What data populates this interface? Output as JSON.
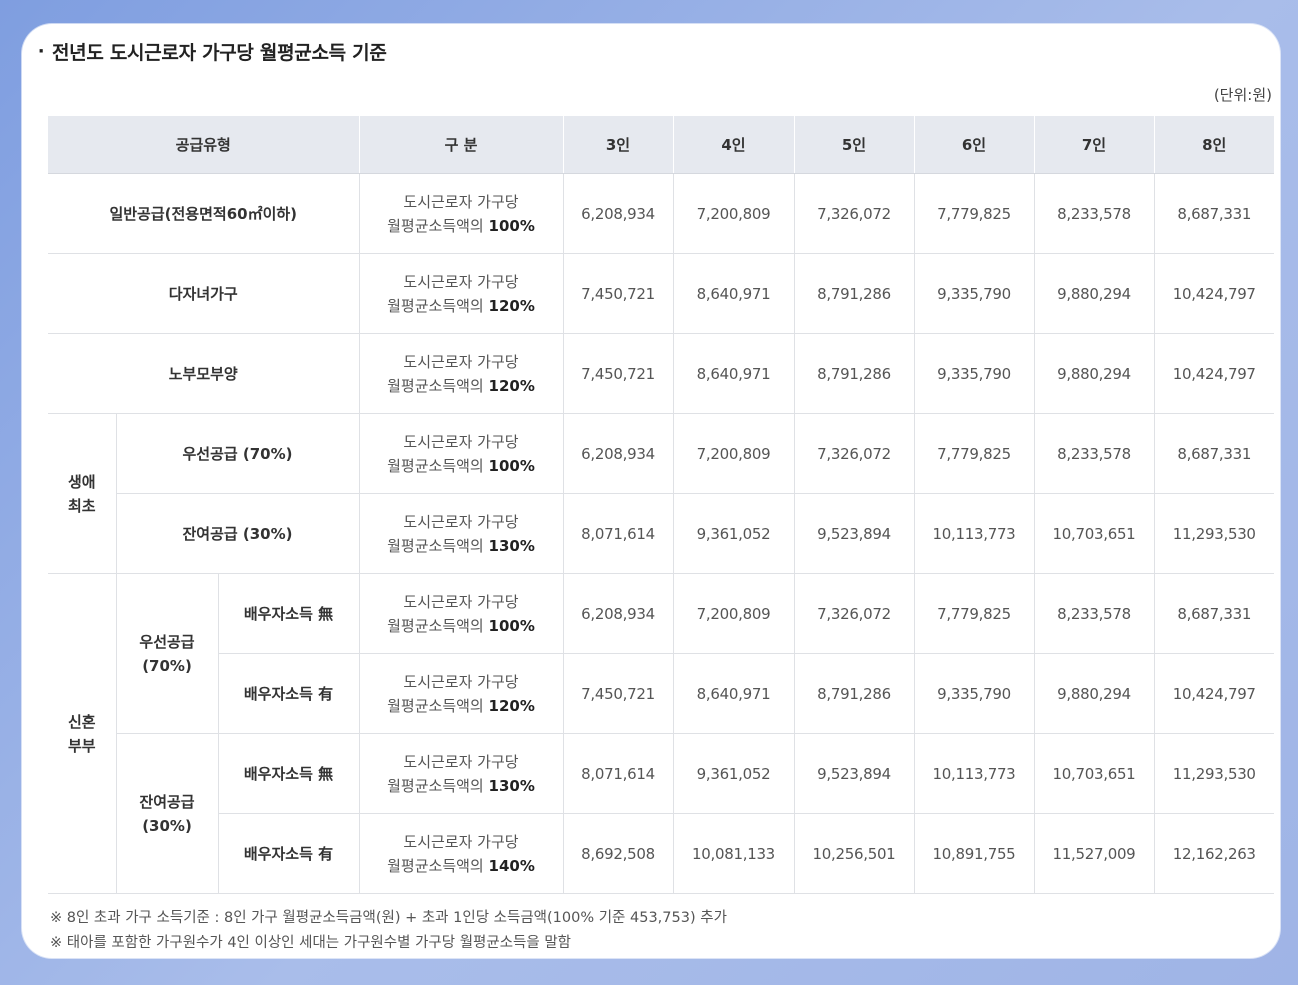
{
  "title": "전년도 도시근로자 가구당 월평균소득 기준",
  "unit": "(단위:원)",
  "header": {
    "supply_type": "공급유형",
    "division": "구 분",
    "columns": [
      "3인",
      "4인",
      "5인",
      "6인",
      "7인",
      "8인"
    ]
  },
  "desc_prefix_line1": "도시근로자 가구당",
  "desc_prefix_line2": "월평균소득액의",
  "rows": [
    {
      "label": "일반공급(전용면적60㎡이하)",
      "pct": "100%",
      "values": [
        "6,208,934",
        "7,200,809",
        "7,326,072",
        "7,779,825",
        "8,233,578",
        "8,687,331"
      ]
    },
    {
      "label": "다자녀가구",
      "pct": "120%",
      "values": [
        "7,450,721",
        "8,640,971",
        "8,791,286",
        "9,335,790",
        "9,880,294",
        "10,424,797"
      ]
    },
    {
      "label": "노부모부양",
      "pct": "120%",
      "values": [
        "7,450,721",
        "8,640,971",
        "8,791,286",
        "9,335,790",
        "9,880,294",
        "10,424,797"
      ]
    },
    {
      "label": "우선공급 (70%)",
      "pct": "100%",
      "values": [
        "6,208,934",
        "7,200,809",
        "7,326,072",
        "7,779,825",
        "8,233,578",
        "8,687,331"
      ]
    },
    {
      "label": "잔여공급 (30%)",
      "pct": "130%",
      "values": [
        "8,071,614",
        "9,361,052",
        "9,523,894",
        "10,113,773",
        "10,703,651",
        "11,293,530"
      ]
    },
    {
      "label": "배우자소득 無",
      "pct": "100%",
      "values": [
        "6,208,934",
        "7,200,809",
        "7,326,072",
        "7,779,825",
        "8,233,578",
        "8,687,331"
      ]
    },
    {
      "label": "배우자소득 有",
      "pct": "120%",
      "values": [
        "7,450,721",
        "8,640,971",
        "8,791,286",
        "9,335,790",
        "9,880,294",
        "10,424,797"
      ]
    },
    {
      "label": "배우자소득 無",
      "pct": "130%",
      "values": [
        "8,071,614",
        "9,361,052",
        "9,523,894",
        "10,113,773",
        "10,703,651",
        "11,293,530"
      ]
    },
    {
      "label": "배우자소득 有",
      "pct": "140%",
      "values": [
        "8,692,508",
        "10,081,133",
        "10,256,501",
        "10,891,755",
        "11,527,009",
        "12,162,263"
      ]
    }
  ],
  "groups": {
    "first_time_l1": "생애",
    "first_time_l2": "최초",
    "newlywed_l1": "신혼",
    "newlywed_l2": "부부",
    "priority_l1": "우선공급",
    "priority_l2": "(70%)",
    "remaining_l1": "잔여공급",
    "remaining_l2": "(30%)"
  },
  "notes": [
    "※ 8인 초과 가구 소득기준 : 8인 가구 월평균소득금액(원) + 초과 1인당 소득금액(100% 기준 453,753) 추가",
    "※ 태아를 포함한 가구원수가 4인 이상인 세대는 가구원수별 가구당 월평균소득을 말함"
  ]
}
